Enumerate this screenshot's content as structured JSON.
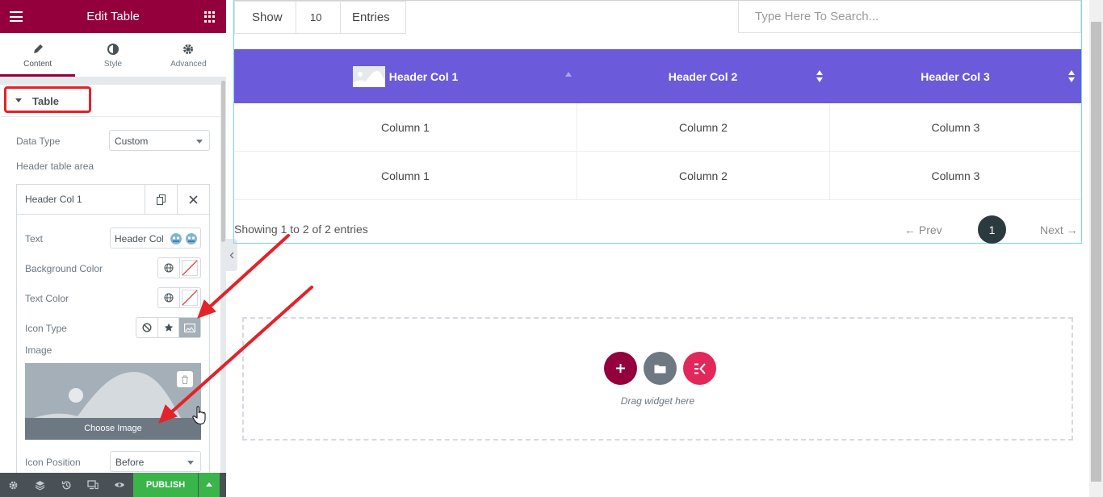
{
  "panel": {
    "title": "Edit Table",
    "tabs": [
      {
        "label": "Content",
        "icon": "pencil-icon"
      },
      {
        "label": "Style",
        "icon": "contrast-icon"
      },
      {
        "label": "Advanced",
        "icon": "gear-icon"
      }
    ],
    "section_title": "Table",
    "data_type_label": "Data Type",
    "data_type_value": "Custom",
    "header_area_label": "Header table area",
    "header_item_title": "Header Col 1",
    "text_label": "Text",
    "text_value": "Header Col",
    "background_color_label": "Background Color",
    "text_color_label": "Text Color",
    "icon_type_label": "Icon Type",
    "image_label": "Image",
    "choose_image_label": "Choose Image",
    "icon_position_label": "Icon Position",
    "icon_position_value": "Before",
    "publish_label": "PUBLISH"
  },
  "table": {
    "show_label": "Show",
    "entries_count": "10",
    "entries_label": "Entries",
    "search_placeholder": "Type Here To Search...",
    "headers": [
      "Header Col 1",
      "Header Col 2",
      "Header Col 3"
    ],
    "rows": [
      [
        "Column 1",
        "Column 2",
        "Column 3"
      ],
      [
        "Column 1",
        "Column 2",
        "Column 3"
      ]
    ],
    "info": "Showing 1 to 2 of 2 entries",
    "prev_label": "Prev",
    "next_label": "Next",
    "current_page": "1"
  },
  "dropzone": {
    "label": "Drag widget here"
  },
  "colors": {
    "brand": "#93003c",
    "table_header": "#6b5ad9",
    "publish": "#39b54a",
    "annotation": "#e3222a"
  }
}
